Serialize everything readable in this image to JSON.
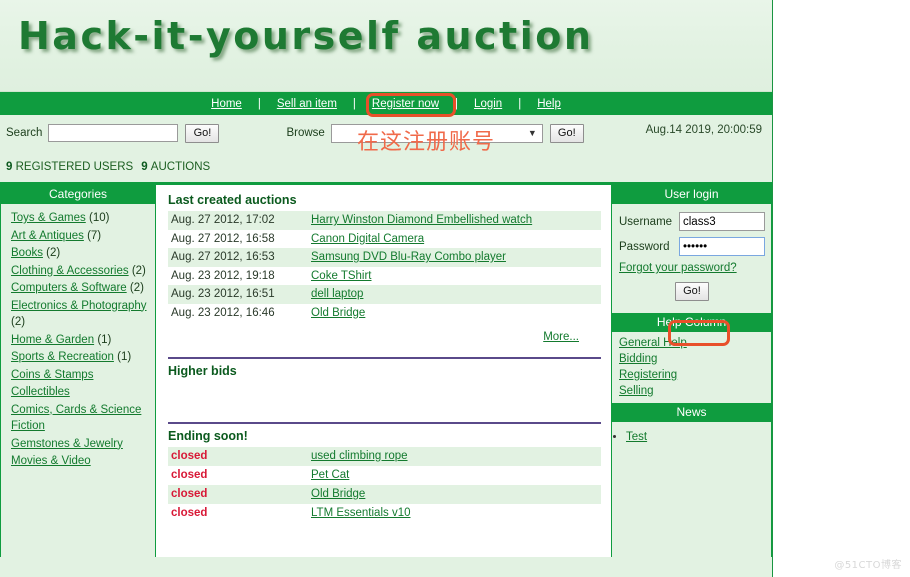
{
  "site": {
    "logo": "Hack-it-yourself auction",
    "colors": {
      "brand_green": "#0f9c3f",
      "pale_green": "#e2f2e2",
      "link_green": "#137a2e",
      "annotation_red": "#e8502a",
      "closed_red": "#d81836",
      "rule_purple": "#5a4a8a"
    }
  },
  "nav": {
    "separator": "|",
    "items": [
      {
        "label": "Home"
      },
      {
        "label": "Sell an item"
      },
      {
        "label": "Register now"
      },
      {
        "label": "Login"
      },
      {
        "label": "Help"
      }
    ]
  },
  "search": {
    "label": "Search",
    "value": "",
    "placeholder": "",
    "go_label": "Go!",
    "browse_label": "Browse",
    "browse_value": "",
    "browse_go_label": "Go!",
    "dropdown_arrow": "▼"
  },
  "clock": {
    "datetime": "Aug.14 2019, 20:00:59"
  },
  "stats": {
    "users_count": "9",
    "users_label": "REGISTERED USERS",
    "auctions_count": "9",
    "auctions_label": "AUCTIONS"
  },
  "categories": {
    "header": "Categories",
    "items": [
      {
        "label": "Toys & Games",
        "count": "(10)"
      },
      {
        "label": "Art & Antiques",
        "count": "(7)"
      },
      {
        "label": "Books",
        "count": "(2)"
      },
      {
        "label": "Clothing & Accessories",
        "count": "(2)"
      },
      {
        "label": "Computers & Software",
        "count": "(2)"
      },
      {
        "label": "Electronics & Photography",
        "count": "(2)"
      },
      {
        "label": "Home & Garden",
        "count": "(1)"
      },
      {
        "label": "Sports & Recreation",
        "count": "(1)"
      },
      {
        "label": "Coins & Stamps",
        "count": ""
      },
      {
        "label": "Collectibles",
        "count": ""
      },
      {
        "label": "Comics, Cards & Science Fiction",
        "count": ""
      },
      {
        "label": "Gemstones & Jewelry",
        "count": ""
      },
      {
        "label": "Movies & Video",
        "count": ""
      }
    ]
  },
  "last_auctions": {
    "header": "Last created auctions",
    "rows": [
      {
        "date": "Aug. 27 2012, 17:02",
        "title": "Harry Winston Diamond Embellished watch"
      },
      {
        "date": "Aug. 27 2012, 16:58",
        "title": "Canon Digital Camera"
      },
      {
        "date": "Aug. 27 2012, 16:53",
        "title": "Samsung DVD Blu-Ray Combo player"
      },
      {
        "date": "Aug. 23 2012, 19:18",
        "title": "Coke TShirt"
      },
      {
        "date": "Aug. 23 2012, 16:51",
        "title": "dell laptop"
      },
      {
        "date": "Aug. 23 2012, 16:46",
        "title": "Old Bridge"
      }
    ],
    "more_label": "More..."
  },
  "higher_bids": {
    "header": "Higher bids",
    "rows": []
  },
  "ending_soon": {
    "header": "Ending soon!",
    "rows": [
      {
        "status": "closed",
        "title": "used climbing rope"
      },
      {
        "status": "closed",
        "title": "Pet Cat"
      },
      {
        "status": "closed",
        "title": "Old Bridge"
      },
      {
        "status": "closed",
        "title": "LTM Essentials v10"
      }
    ]
  },
  "user_login": {
    "header": "User login",
    "username_label": "Username",
    "username_value": "class3",
    "password_label": "Password",
    "password_value": "••••••",
    "forgot_label": "Forgot your password?",
    "go_label": "Go!"
  },
  "help_column": {
    "header": "Help Column",
    "items": [
      {
        "label": "General Help"
      },
      {
        "label": "Bidding"
      },
      {
        "label": "Registering"
      },
      {
        "label": "Selling"
      }
    ]
  },
  "news": {
    "header": "News",
    "items": [
      {
        "label": "Test"
      }
    ]
  },
  "annotations": {
    "register_note": "在这注册账号"
  },
  "watermark": {
    "text": "@51CTO博客"
  }
}
